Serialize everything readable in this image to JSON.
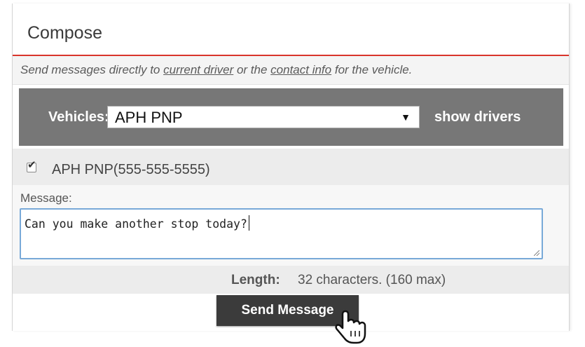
{
  "compose": {
    "title": "Compose",
    "intro": {
      "prefix": "Send messages directly to ",
      "current_driver_link": "current driver",
      "middle": " or the ",
      "contact_info_link": "contact info",
      "suffix": " for the vehicle."
    }
  },
  "vehicles": {
    "label": "Vehicles:",
    "selected": "APH PNP",
    "caret": "▼",
    "show_drivers": "show drivers"
  },
  "recipient": {
    "checked": true,
    "check_glyph": "✔",
    "label": "APH PNP(555-555-5555)"
  },
  "message": {
    "label": "Message:",
    "value": "Can you make another stop today?"
  },
  "length": {
    "label": "Length:",
    "value": "32 characters. (160 max)"
  },
  "actions": {
    "send_label": "Send Message"
  },
  "colors": {
    "accent_red": "#d9342b",
    "vehicles_bar": "#777777",
    "button_dark": "#3b3b3b",
    "focus_blue": "#78a9d8"
  },
  "icons": {
    "cursor": "hand-pointer-icon",
    "checkbox": "checkmark-icon",
    "dropdown": "chevron-down-icon"
  }
}
